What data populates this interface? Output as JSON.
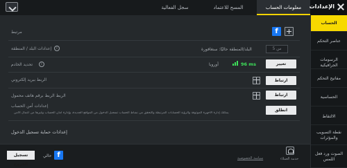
{
  "header": {
    "title": "الإعدادات",
    "tabs": [
      {
        "label": "معلومات الحساب",
        "active": true
      },
      {
        "label": "المسح للاعتماد",
        "active": false
      },
      {
        "label": "سجل الفعالية",
        "active": false
      }
    ]
  },
  "sidebar": {
    "items": [
      {
        "label": "الحساب",
        "active": true
      },
      {
        "label": "عناصر التحكم",
        "active": false
      },
      {
        "label": "الرسومات الجرافيكية",
        "active": false
      },
      {
        "label": "مفاتيح التحكم",
        "active": false
      },
      {
        "label": "الحساسية",
        "active": false
      },
      {
        "label": "الالتقاط",
        "active": false
      },
      {
        "label": "نقطة التصويب والمؤثرات",
        "active": false
      },
      {
        "label": "الصوت ورد فعل اللمس",
        "active": false
      }
    ]
  },
  "account": {
    "linked_label": "مرتبط",
    "region_label": "إعدادات البلد / المنطقة",
    "region_value": "البلد/المنطقة حاليًا: سنغافورة",
    "region_box": "5 س",
    "server_label": "تحديد الخادم",
    "server_name": "أوروبا",
    "server_ping": "96 ms",
    "change_button": "تغيير",
    "email_label": "الربط ببريد إلكتروني",
    "email_button": "ارتباط",
    "phone_label": "الربط الربط برقم هاتف محمول",
    "phone_button": "ارتباط",
    "account_settings_label": "إعدادات أمن الحساب",
    "account_settings_desc": "يمكنك إدارة الأجهزة الموثوقة والرؤية الحسابات المرتبطة والتحقق من نشاط الحساب تسجيل الدخول من المواقع الجديدة، وإدارة أمان الحساب وغيرها من أعمال الأمن",
    "launch_button": "انطلق",
    "login_protection_label": "إعدادات حماية تسجيل الدخول"
  },
  "footer": {
    "logout_button": "تسجيل الخروج",
    "current_label": "حالي",
    "privacy_link": "سياسة الخصوصية",
    "support_label": "خدمة العملاء"
  },
  "icons": {
    "facebook": "facebook-icon",
    "plus": "plus-icon",
    "close": "close-icon",
    "info": "info-icon",
    "gift": "gift-icon",
    "signal": "signal-icon",
    "support": "customer-service-icon"
  },
  "colors": {
    "accent": "#f7d900",
    "facebook": "#1877f2",
    "ping": "#3ee05a"
  }
}
